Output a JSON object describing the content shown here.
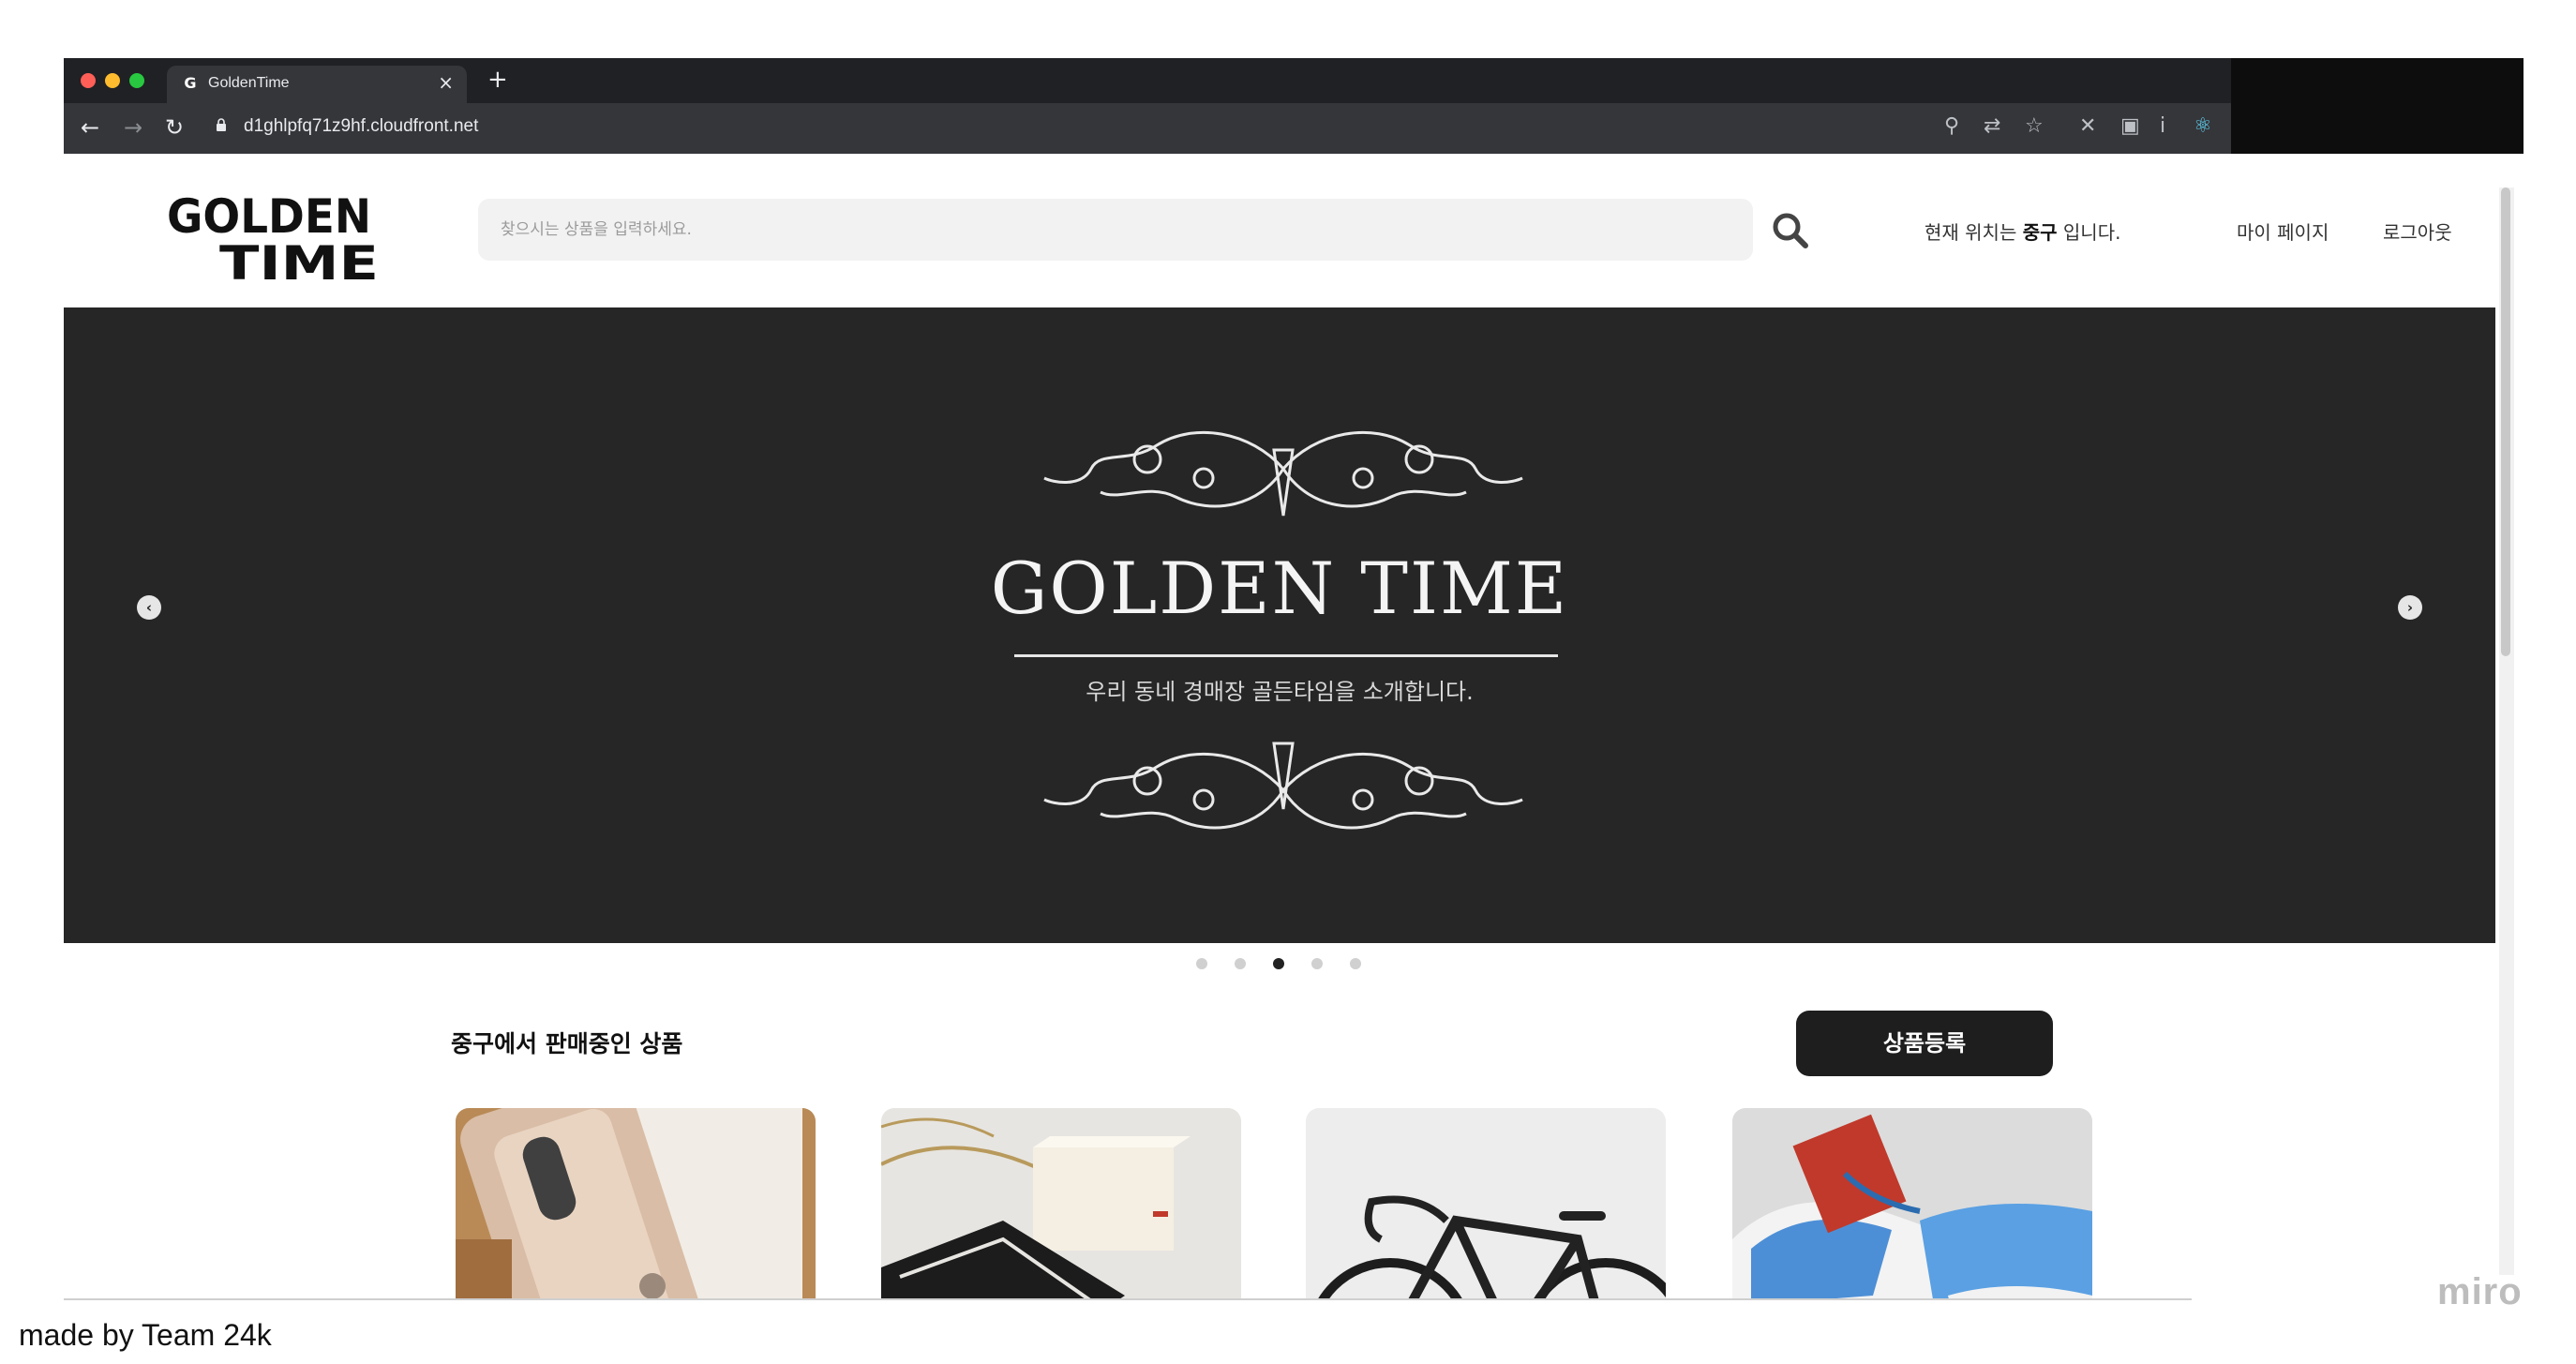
{
  "browser": {
    "tab_title": "GoldenTime",
    "tab_favicon": "G",
    "url": "d1ghlpfq71z9hf.cloudfront.net",
    "toolbar_icons": [
      "back-icon",
      "forward-icon",
      "reload-icon",
      "lock-icon",
      "location-icon",
      "translate-icon",
      "star-icon",
      "extension-icon",
      "extension-icon",
      "extension-icon",
      "react-devtools-icon"
    ]
  },
  "header": {
    "logo_text": [
      "GOLDEN",
      "TIME"
    ],
    "search_placeholder": "찾으시는 상품을 입력하세요.",
    "location_prefix": "현재 위치는 ",
    "location_value": "중구",
    "location_suffix": " 입니다.",
    "mypage": "마이 페이지",
    "logout": "로그아웃"
  },
  "hero": {
    "title": "GOLDEN TIME",
    "subtitle": "우리 동네 경매장 골든타임을 소개합니다.",
    "slide_count": 5,
    "active_slide": 3
  },
  "section": {
    "title": "중구에서 판매중인 상품",
    "register_button": "상품등록"
  },
  "products": [
    {
      "image": "iphone-box-photo"
    },
    {
      "image": "gift-box-photo"
    },
    {
      "image": "road-bike-photo"
    },
    {
      "image": "sneakers-photo"
    }
  ],
  "footer": {
    "caption": "made by Team 24k",
    "watermark": "miro"
  },
  "colors": {
    "hero_bg": "#262626",
    "button_bg": "#1e1e1e",
    "search_bg": "#f2f2f2"
  }
}
